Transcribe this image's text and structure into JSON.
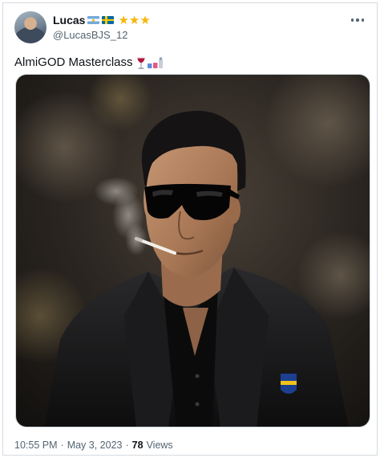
{
  "author": {
    "display_name": "Lucas",
    "handle": "@LucasBJS_12",
    "badges": [
      "argentina-flag-icon",
      "sweden-flag-icon"
    ],
    "stars": "★★★"
  },
  "tweet": {
    "text": "AlmiGOD Masterclass",
    "emojis": [
      "wine-glass-icon",
      "eyeglasses-icon"
    ]
  },
  "media": {
    "alt_icon": "photo-portrait"
  },
  "meta": {
    "time": "10:55 PM",
    "separator": "·",
    "date": "May 3, 2023",
    "views_count": "78",
    "views_label": "Views"
  },
  "colors": {
    "text": "#0f1419",
    "secondary": "#536471",
    "star": "#f5b60a",
    "border": "#cfd9de"
  }
}
